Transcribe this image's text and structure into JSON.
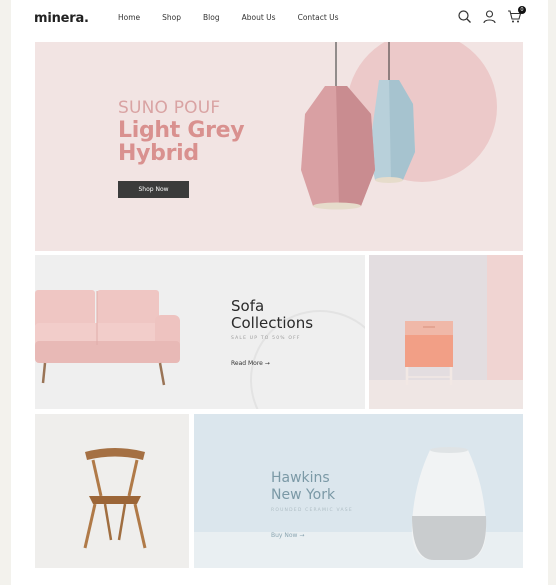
{
  "brand": {
    "logo": "minera."
  },
  "nav": {
    "items": [
      "Home",
      "Shop",
      "Blog",
      "About Us",
      "Contact Us"
    ]
  },
  "header_icons": {
    "search": "search-icon",
    "account": "user-icon",
    "cart": "cart-icon",
    "cart_count": "0"
  },
  "hero": {
    "kicker": "SUNO POUF",
    "title_line1": "Light Grey",
    "title_line2": "Hybrid",
    "button": "Shop Now",
    "colors": {
      "background": "#f2e4e3",
      "title": "#d9918f",
      "button": "#3b3b3b"
    }
  },
  "sofa_banner": {
    "title_line1": "Sofa",
    "title_line2": "Collections",
    "subtitle": "SALE UP TO 50% OFF",
    "link": "Read More →"
  },
  "vase_banner": {
    "title_line1": "Hawkins",
    "title_line2": "New York",
    "subtitle": "ROUNDED CERAMIC VASE",
    "link": "Buy Now →"
  }
}
